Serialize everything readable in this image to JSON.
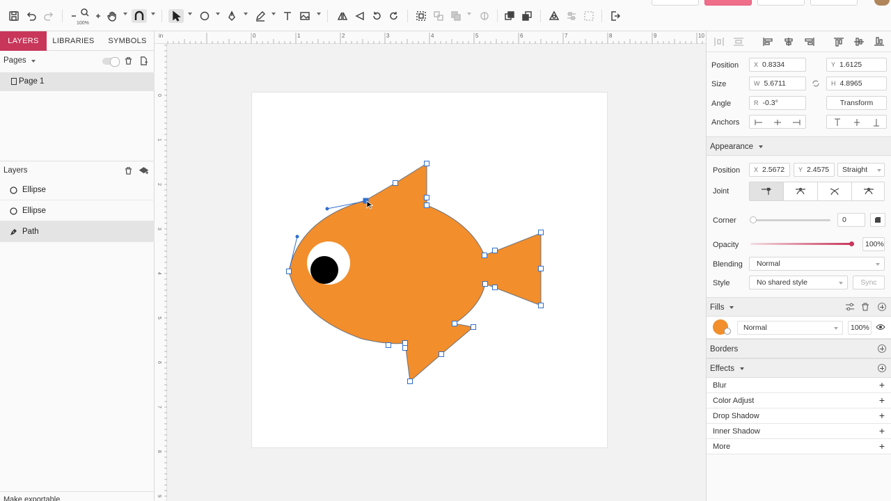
{
  "toolbar": {
    "zoom_label": "100%",
    "icons": [
      "save-icon",
      "undo-icon",
      "redo-icon",
      "zoom-out-icon",
      "zoom-icon",
      "zoom-in-icon",
      "hand-icon",
      "snap-magnet-icon",
      "pointer-icon",
      "ellipse-icon",
      "pen-icon",
      "pencil-icon",
      "text-icon",
      "image-icon",
      "flip-horizontal-icon",
      "flip-vertical-icon",
      "rotate-left-icon",
      "rotate-right-icon",
      "group-icon",
      "ungroup-icon",
      "boolean-icon",
      "mask-icon",
      "bring-forward-icon",
      "send-backward-icon",
      "symbol-icon",
      "component-icon",
      "crop-icon",
      "export-icon"
    ]
  },
  "left_panel": {
    "tabs": [
      "LAYERS",
      "LIBRARIES",
      "SYMBOLS"
    ],
    "pages_title": "Pages",
    "pages": [
      {
        "label": "Page 1",
        "selected": true
      }
    ],
    "layers_title": "Layers",
    "layers": [
      {
        "label": "Ellipse",
        "icon": "ellipse-icon",
        "selected": false
      },
      {
        "label": "Ellipse",
        "icon": "ellipse-icon",
        "selected": false
      },
      {
        "label": "Path",
        "icon": "path-pen-icon",
        "selected": true
      }
    ],
    "bottom_label": "Make exportable"
  },
  "rulers": {
    "top_labels": [
      "0",
      "1",
      "2",
      "3",
      "4",
      "5",
      "6",
      "7",
      "8",
      "9",
      "10"
    ],
    "top_origin_label": "in",
    "left_labels": [
      "0",
      "1",
      "2",
      "3",
      "4",
      "5",
      "6",
      "7",
      "8",
      "9"
    ]
  },
  "colors": {
    "accent": "#c8365a",
    "fish_fill": "#f28e2b",
    "handle": "#2f6fcf",
    "eye_white": "#ffffff",
    "pupil": "#000000"
  },
  "right_panel": {
    "position_label": "Position",
    "x_prefix": "X",
    "x_value": "0.8334",
    "y_prefix": "Y",
    "y_value": "1.6125",
    "size_label": "Size",
    "w_prefix": "W",
    "w_value": "5.6711",
    "h_prefix": "H",
    "h_value": "4.8965",
    "angle_label": "Angle",
    "r_prefix": "R",
    "r_value": "-0.3°",
    "transform_button": "Transform",
    "anchors_label": "Anchors",
    "appearance_title": "Appearance",
    "ap_position_label": "Position",
    "ap_x_prefix": "X",
    "ap_x_value": "2.5672",
    "ap_y_prefix": "Y",
    "ap_y_value": "2.4575",
    "ap_node_type": "Straight",
    "joint_label": "Joint",
    "corner_label": "Corner",
    "corner_value": "0",
    "opacity_label": "Opacity",
    "opacity_value": "100%",
    "blending_label": "Blending",
    "blending_value": "Normal",
    "style_label": "Style",
    "style_value": "No shared style",
    "sync_button": "Sync",
    "fills_title": "Fills",
    "fill_blend": "Normal",
    "fill_opacity": "100%",
    "borders_title": "Borders",
    "effects_title": "Effects",
    "effects": [
      "Blur",
      "Color Adjust",
      "Drop Shadow",
      "Inner Shadow",
      "More"
    ]
  }
}
